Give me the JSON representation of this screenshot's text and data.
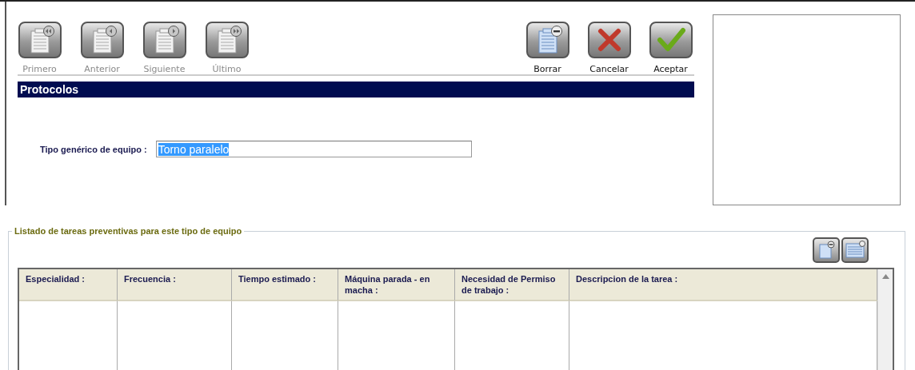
{
  "toolbar": {
    "navigation": [
      {
        "kind": "first",
        "label": "Primero",
        "disabled": true
      },
      {
        "kind": "previous",
        "label": "Anterior",
        "disabled": true
      },
      {
        "kind": "next",
        "label": "Siguiente",
        "disabled": true
      },
      {
        "kind": "last",
        "label": "Último",
        "disabled": true
      }
    ],
    "actions": [
      {
        "kind": "delete",
        "label": "Borrar",
        "disabled": false
      },
      {
        "kind": "cancel",
        "label": "Cancelar",
        "disabled": false
      },
      {
        "kind": "accept",
        "label": "Aceptar",
        "disabled": false
      }
    ]
  },
  "section_title": "Protocolos",
  "field": {
    "label": "Tipo genérico de equipo :",
    "value": "Torno paralelo",
    "selected": true
  },
  "group": {
    "legend": "Listado de tareas preventivas para este tipo de equipo",
    "buttons": [
      {
        "kind": "remove"
      },
      {
        "kind": "list"
      }
    ],
    "table": {
      "columns": [
        "Especialidad :",
        "Frecuencia :",
        "Tiempo estimado :",
        "Máquina parada - en macha :",
        "Necesidad de Permiso de trabajo :",
        "Descripcion de la tarea :"
      ]
    }
  }
}
